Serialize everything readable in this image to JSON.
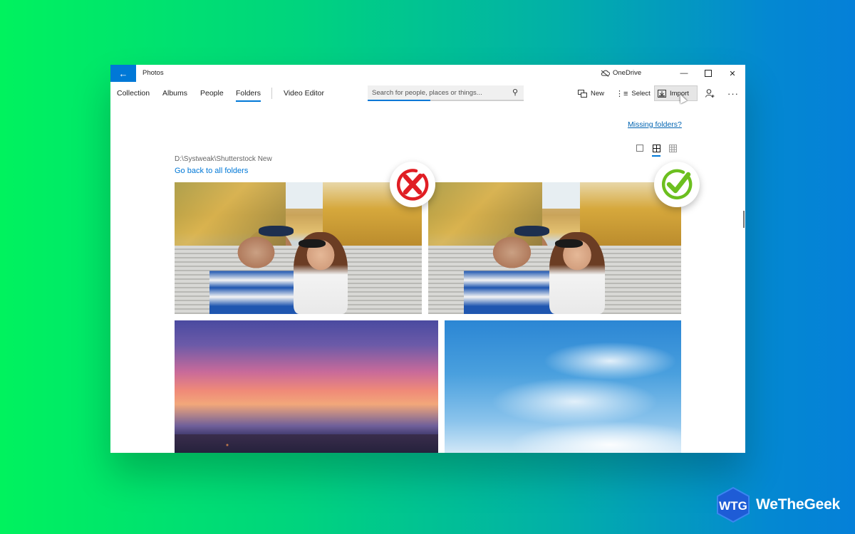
{
  "window": {
    "app_title": "Photos",
    "onedrive_label": "OneDrive",
    "controls": {
      "minimize": "minimize",
      "maximize": "maximize",
      "close": "close"
    }
  },
  "nav": {
    "tabs": [
      {
        "label": "Collection",
        "active": false
      },
      {
        "label": "Albums",
        "active": false
      },
      {
        "label": "People",
        "active": false
      },
      {
        "label": "Folders",
        "active": true
      },
      {
        "label": "Video Editor",
        "active": false
      }
    ]
  },
  "search": {
    "placeholder": "Search for people, places or things...",
    "value": "",
    "progress_percent": 40
  },
  "toolbar": {
    "new_label": "New",
    "select_label": "Select",
    "import_label": "Import",
    "import_hovered": true
  },
  "content": {
    "missing_folders_link": "Missing folders?",
    "view_modes": [
      "single",
      "medium-grid",
      "small-grid"
    ],
    "active_view_mode": "medium-grid",
    "folder_path": "D:\\Systweak\\Shutterstock New",
    "go_back_link": "Go back to all folders",
    "photos": [
      {
        "subject": "couple selfie at temple",
        "badge": "wrong",
        "badge_color": "#e01e24"
      },
      {
        "subject": "couple selfie at temple",
        "badge": "correct",
        "badge_color": "#6cbf1f"
      },
      {
        "subject": "sunset over city"
      },
      {
        "subject": "blue sky with clouds"
      }
    ]
  },
  "branding": {
    "logo_text": "WeTheGeek",
    "logo_monogram": "WTG"
  },
  "colors": {
    "accent": "#0078d7",
    "link": "#0063b1",
    "background_gradient_start": "#00f25e",
    "background_gradient_end": "#0580d8"
  }
}
